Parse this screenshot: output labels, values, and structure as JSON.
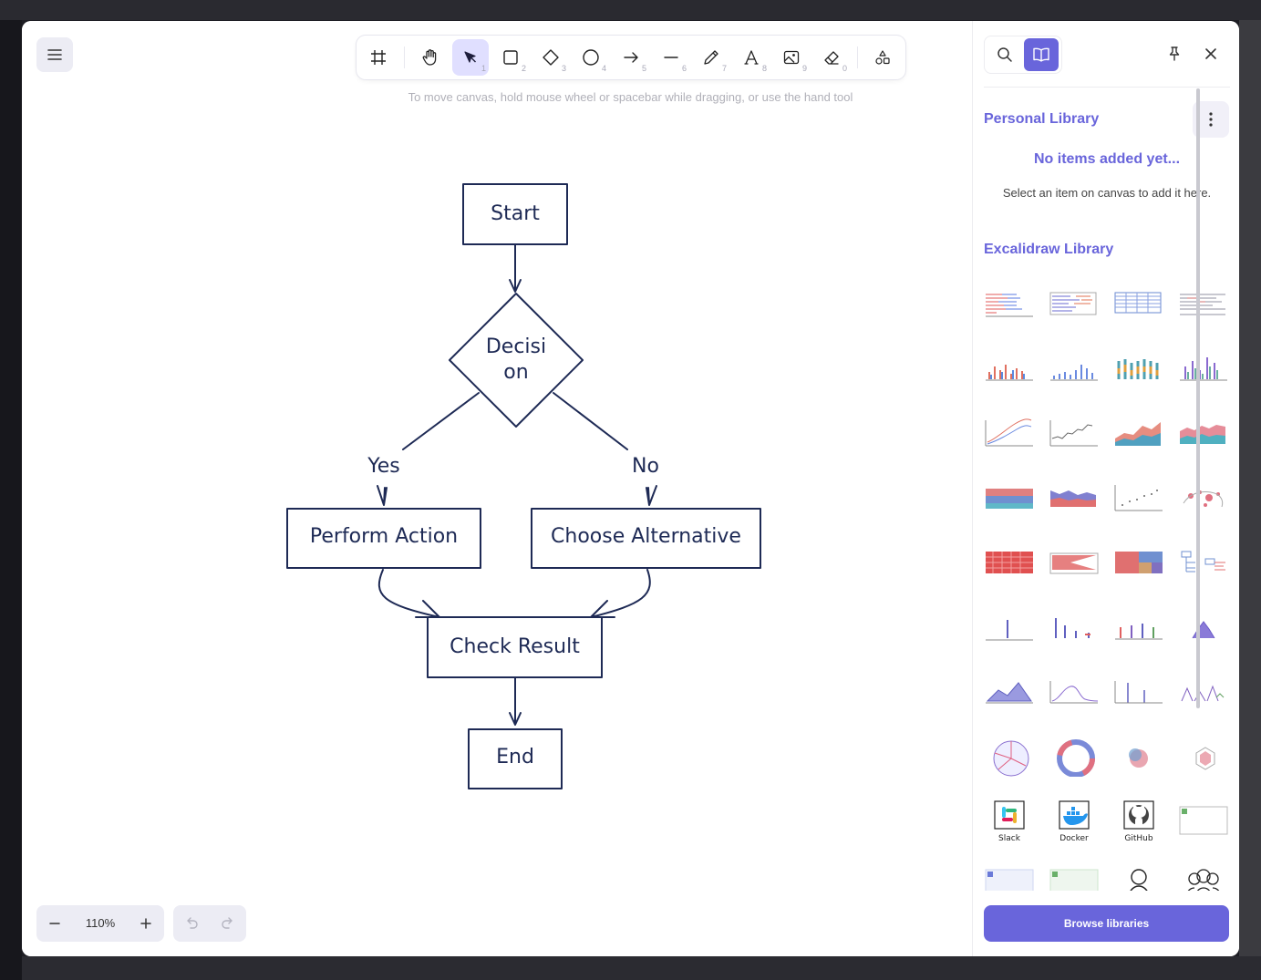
{
  "toolbar": {
    "tools": [
      {
        "name": "frame",
        "key": ""
      },
      {
        "name": "hand",
        "key": ""
      },
      {
        "name": "selection",
        "key": "1"
      },
      {
        "name": "rectangle",
        "key": "2"
      },
      {
        "name": "diamond",
        "key": "3"
      },
      {
        "name": "ellipse",
        "key": "4"
      },
      {
        "name": "arrow",
        "key": "5"
      },
      {
        "name": "line",
        "key": "6"
      },
      {
        "name": "draw",
        "key": "7"
      },
      {
        "name": "text",
        "key": "8"
      },
      {
        "name": "image",
        "key": "9"
      },
      {
        "name": "eraser",
        "key": "0"
      },
      {
        "name": "more-shapes",
        "key": ""
      }
    ],
    "active_tool": "selection"
  },
  "hint": "To move canvas, hold mouse wheel or spacebar while dragging, or use the hand tool",
  "diagram": {
    "start": "Start",
    "decision_line1": "Decisi",
    "decision_line2": "on",
    "yes": "Yes",
    "no": "No",
    "perform": "Perform Action",
    "choose": "Choose Alternative",
    "check": "Check Result",
    "end": "End",
    "stroke_color": "#1e2a55"
  },
  "zoom": {
    "value": "110%"
  },
  "sidebar": {
    "personal_title": "Personal Library",
    "empty_title": "No items added yet...",
    "empty_sub": "Select an item on canvas to add it here.",
    "excalidraw_title": "Excalidraw Library",
    "items": {
      "slack": "Slack",
      "docker": "Docker",
      "github": "GitHub"
    },
    "browse": "Browse libraries",
    "accent": "#6965db"
  }
}
